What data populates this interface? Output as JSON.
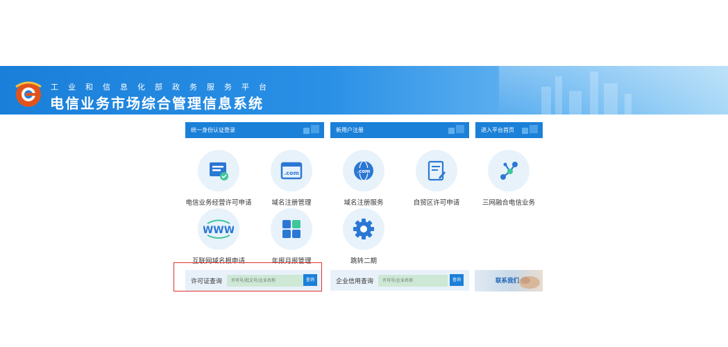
{
  "header": {
    "subtitle": "工业和信息化部政务服务平台",
    "title": "电信业务市场综合管理信息系统"
  },
  "tabs": [
    {
      "label": "统一身份认证登录"
    },
    {
      "label": "新用户注册"
    },
    {
      "label": "进入平台首页"
    }
  ],
  "services": [
    {
      "label": "电信业务经营许可申请",
      "icon": "license-document-icon"
    },
    {
      "label": "域名注册管理",
      "icon": "dotcom-window-icon"
    },
    {
      "label": "域名注册服务",
      "icon": "dotcom-globe-icon"
    },
    {
      "label": "自贸区许可申请",
      "icon": "form-edit-icon"
    },
    {
      "label": "三网融合电信业务",
      "icon": "network-nodes-icon"
    },
    {
      "label": "互联网域名根申请",
      "icon": "www-icon"
    },
    {
      "label": "年报月报管理",
      "icon": "grid-blocks-icon"
    },
    {
      "label": "跳转二期",
      "icon": "gear-icon"
    }
  ],
  "query": {
    "license": {
      "label": "许可证查询",
      "placeholder": "许可号/批文号/企业名称",
      "button": "查询"
    },
    "credit": {
      "label": "企业信用查询",
      "placeholder": "许可号/企业名称",
      "button": "查询"
    },
    "contact": "联系我们"
  },
  "colors": {
    "primary": "#1b80d8",
    "highlight": "#e0302f"
  }
}
